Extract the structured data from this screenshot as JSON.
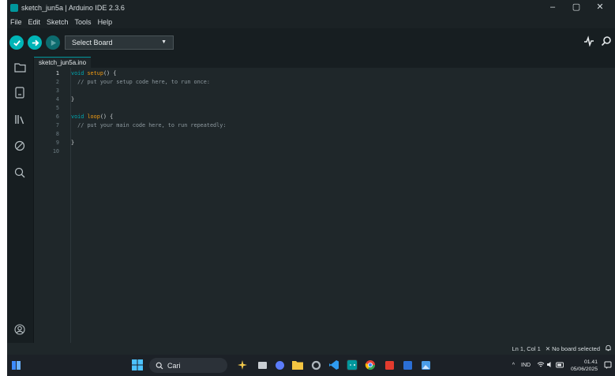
{
  "window": {
    "title": "sketch_jun5a | Arduino IDE 2.3.6",
    "controls": {
      "minimize": "–",
      "maximize": "▢",
      "close": "✕"
    }
  },
  "menu": [
    "File",
    "Edit",
    "Sketch",
    "Tools",
    "Help"
  ],
  "toolbar": {
    "board_select_label": "Select Board",
    "icons": {
      "verify": "check-icon",
      "upload": "arrow-right-icon",
      "debug": "debug-icon",
      "serial_plotter": "serial-plotter-icon",
      "serial_monitor": "serial-monitor-icon"
    }
  },
  "sidebar": {
    "items": [
      "folder-icon",
      "board-manager-icon",
      "library-icon",
      "debug-icon",
      "search-icon"
    ],
    "bottom": "account-icon"
  },
  "tab": {
    "label": "sketch_jun5a.ino"
  },
  "editor": {
    "line_numbers": [
      "1",
      "2",
      "3",
      "4",
      "5",
      "6",
      "7",
      "8",
      "9",
      "10"
    ],
    "lines": [
      {
        "kw": "void",
        "fn": "setup",
        "rest": "() {"
      },
      {
        "comment": "  // put your setup code here, to run once:"
      },
      {},
      {
        "plain": "}"
      },
      {},
      {
        "kw": "void",
        "fn": "loop",
        "rest": "() {"
      },
      {
        "comment": "  // put your main code here, to run repeatedly:"
      },
      {},
      {
        "plain": "}"
      },
      {}
    ]
  },
  "status": {
    "cursor": "Ln 1, Col 1",
    "board": "✕ No board selected",
    "notification_icon": "bell-icon"
  },
  "taskbar": {
    "search_placeholder": "Cari",
    "tray_lang": "IND",
    "time": "01.41",
    "date": "05/06/2025",
    "accent_color": "#00979c"
  }
}
